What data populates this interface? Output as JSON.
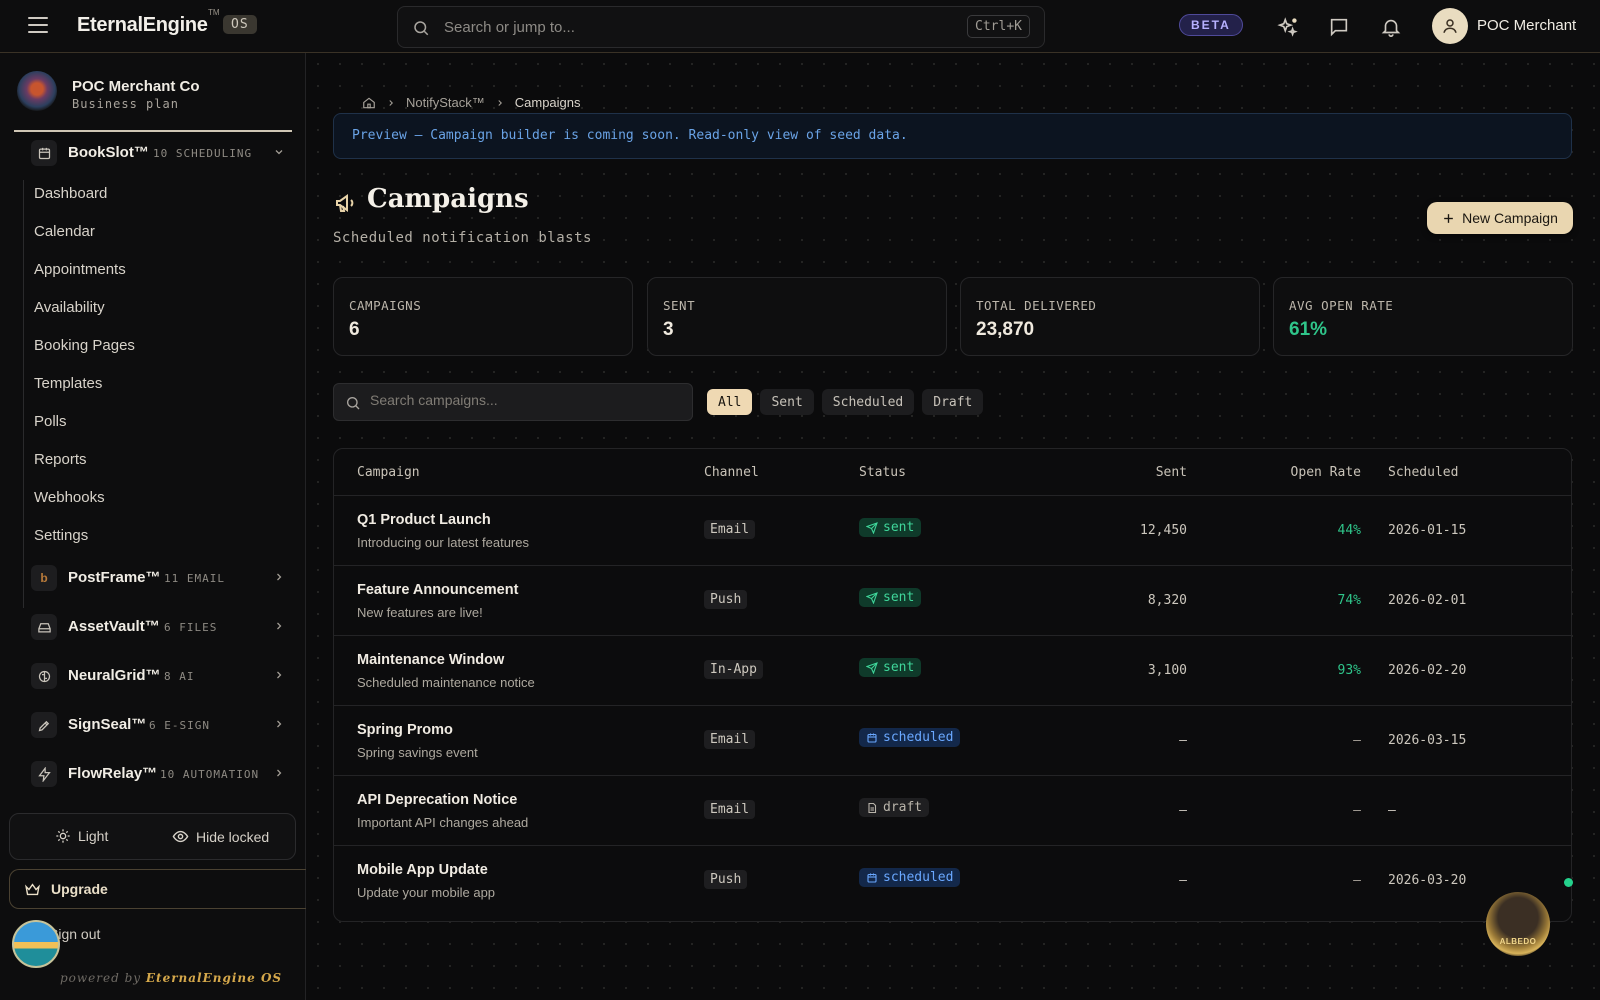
{
  "topbar": {
    "brand": "EternalEngine",
    "brand_tm": "TM",
    "os_badge": "OS",
    "search_placeholder": "Search or jump to...",
    "search_shortcut": "Ctrl+K",
    "beta": "BETA",
    "user_name": "POC Merchant"
  },
  "sidebar": {
    "org_name": "POC Merchant Co",
    "org_plan": "Business plan",
    "expanded_section": {
      "title": "BookSlot™",
      "count": "10 SCHEDULING",
      "icon": "calendar-icon"
    },
    "nav_items": [
      "Dashboard",
      "Calendar",
      "Appointments",
      "Availability",
      "Booking Pages",
      "Templates",
      "Polls",
      "Reports",
      "Webhooks",
      "Settings"
    ],
    "sections": [
      {
        "title": "PostFrame™",
        "count": "11 EMAIL",
        "icon": "postframe-icon"
      },
      {
        "title": "AssetVault™",
        "count": "6 FILES",
        "icon": "drive-icon"
      },
      {
        "title": "NeuralGrid™",
        "count": "8 AI",
        "icon": "brain-icon"
      },
      {
        "title": "SignSeal™",
        "count": "6 E-SIGN",
        "icon": "pen-icon"
      },
      {
        "title": "FlowRelay™",
        "count": "10 AUTOMATION",
        "icon": "bolt-icon"
      }
    ],
    "theme_label": "Light",
    "hide_locked_label": "Hide locked",
    "upgrade_label": "Upgrade",
    "signout_label": "Sign out",
    "powered_prefix": "powered by",
    "powered_brand": "EternalEngine OS"
  },
  "main": {
    "breadcrumb": [
      "NotifyStack™",
      "Campaigns"
    ],
    "preview_banner": "Preview — Campaign builder is coming soon. Read-only view of seed data.",
    "title": "Campaigns",
    "subtitle": "Scheduled notification blasts",
    "new_button": "New Campaign",
    "stats": [
      {
        "label": "CAMPAIGNS",
        "value": "6",
        "color": "#efe9de"
      },
      {
        "label": "SENT",
        "value": "3",
        "color": "#efe9de"
      },
      {
        "label": "TOTAL DELIVERED",
        "value": "23,870",
        "color": "#efe9de"
      },
      {
        "label": "AVG OPEN RATE",
        "value": "61%",
        "color": "#2fc58a"
      }
    ],
    "search_placeholder": "Search campaigns...",
    "filters": [
      "All",
      "Sent",
      "Scheduled",
      "Draft"
    ],
    "active_filter": "All",
    "columns": [
      "Campaign",
      "Channel",
      "Status",
      "Sent",
      "Open Rate",
      "Scheduled"
    ],
    "rows": [
      {
        "name": "Q1 Product Launch",
        "desc": "Introducing our latest features",
        "channel": "Email",
        "status": "sent",
        "sent": "12,450",
        "open_rate": "44%",
        "scheduled": "2026-01-15"
      },
      {
        "name": "Feature Announcement",
        "desc": "New features are live!",
        "channel": "Push",
        "status": "sent",
        "sent": "8,320",
        "open_rate": "74%",
        "scheduled": "2026-02-01"
      },
      {
        "name": "Maintenance Window",
        "desc": "Scheduled maintenance notice",
        "channel": "In-App",
        "status": "sent",
        "sent": "3,100",
        "open_rate": "93%",
        "scheduled": "2026-02-20"
      },
      {
        "name": "Spring Promo",
        "desc": "Spring savings event",
        "channel": "Email",
        "status": "scheduled",
        "sent": "—",
        "open_rate": "—",
        "scheduled": "2026-03-15"
      },
      {
        "name": "API Deprecation Notice",
        "desc": "Important API changes ahead",
        "channel": "Email",
        "status": "draft",
        "sent": "—",
        "open_rate": "—",
        "scheduled": "—"
      },
      {
        "name": "Mobile App Update",
        "desc": "Update your mobile app",
        "channel": "Push",
        "status": "scheduled",
        "sent": "—",
        "open_rate": "—",
        "scheduled": "2026-03-20"
      }
    ]
  },
  "assistant": {
    "label": "ALBEDO"
  }
}
